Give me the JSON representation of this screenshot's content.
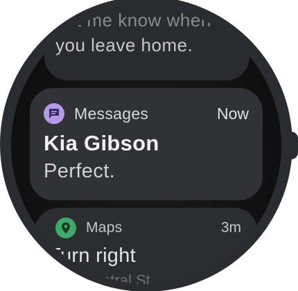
{
  "notifications": [
    {
      "lines": [
        "Let me know when",
        "you leave home."
      ]
    },
    {
      "app": "Messages",
      "time": "Now",
      "title": "Kia Gibson",
      "body": "Perfect.",
      "icon": "message-icon",
      "icon_color": "#b49ae8"
    },
    {
      "app": "Maps",
      "time": "3m",
      "title": "Turn right",
      "subtitle": "onto Central St",
      "icon": "map-pin-icon",
      "icon_color": "#3fa86a"
    }
  ],
  "colors": {
    "card": "#313235",
    "screen": "#0d0d0d",
    "bezel": "#2a2c2f"
  }
}
